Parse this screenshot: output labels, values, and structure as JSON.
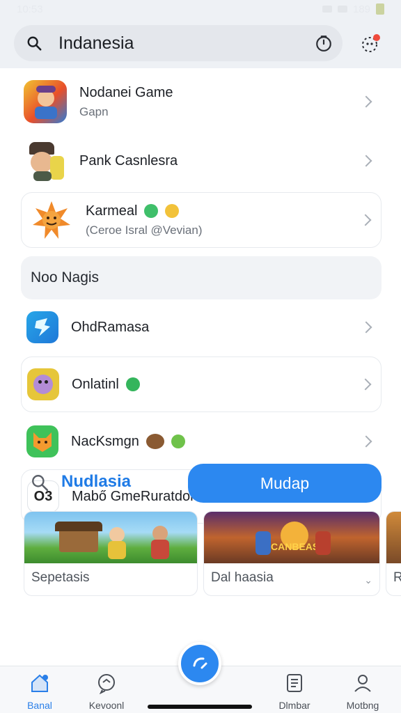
{
  "status": {
    "time": "10:53",
    "battery": "189"
  },
  "search": {
    "query": "Indanesia"
  },
  "list_top": [
    {
      "title": "Nodanei Game",
      "subtitle": "Gapn"
    },
    {
      "title": "Pank Casnlesra",
      "subtitle": ""
    },
    {
      "title": "Karmeal",
      "subtitle": "(Ceroe Isral @Vevian)"
    }
  ],
  "section": {
    "title": "Noo Nagis"
  },
  "list_bottom": [
    {
      "title": "OhdRamasa"
    },
    {
      "title": "Onlatinl"
    },
    {
      "title": "NacKsmgn"
    },
    {
      "title": "Mabő GmeRuratdonh",
      "icon_text": "O3"
    }
  ],
  "actions": {
    "search_label": "Nudlasia",
    "primary_button": "Mudap"
  },
  "gallery": [
    {
      "caption": "Sepetasis",
      "badge": ""
    },
    {
      "caption": "Dal haasia",
      "badge": "CANBEAS"
    },
    {
      "caption": "R"
    }
  ],
  "nav": [
    {
      "label": "Banal",
      "icon": "home-icon"
    },
    {
      "label": "Kevoonl",
      "icon": "chat-icon"
    },
    {
      "label": "Dlmbar",
      "icon": "document-icon"
    },
    {
      "label": "Motbng",
      "icon": "profile-icon"
    }
  ],
  "colors": {
    "accent": "#2c88f0",
    "link": "#1f7be6"
  }
}
